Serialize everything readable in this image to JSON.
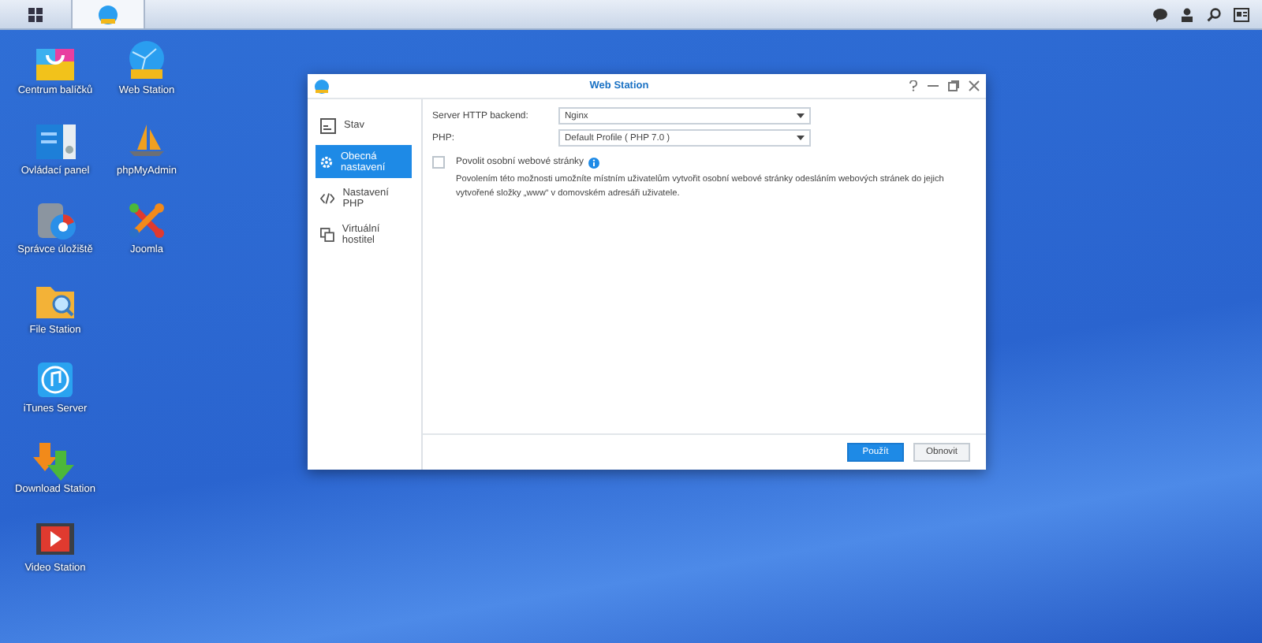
{
  "taskbar": {
    "buttons": [
      {
        "kind": "grid",
        "selected": false
      },
      {
        "kind": "globe",
        "selected": true
      }
    ]
  },
  "desktop_icons": [
    {
      "label": "Centrum balíčků",
      "kind": "bag"
    },
    {
      "label": "Ovládací panel",
      "kind": "panel"
    },
    {
      "label": "Správce úložiště",
      "kind": "storage"
    },
    {
      "label": "File Station",
      "kind": "folder"
    },
    {
      "label": "iTunes Server",
      "kind": "music"
    },
    {
      "label": "Download Station",
      "kind": "download"
    },
    {
      "label": "Video Station",
      "kind": "video"
    },
    {
      "label": "Web Station",
      "kind": "globe"
    },
    {
      "label": "phpMyAdmin",
      "kind": "sail"
    },
    {
      "label": "Joomla",
      "kind": "joomla"
    }
  ],
  "window": {
    "title": "Web Station",
    "sidebar": {
      "items": [
        {
          "label": "Stav",
          "kind": "status",
          "selected": false
        },
        {
          "label": "Obecná nastavení",
          "kind": "gear",
          "selected": true
        },
        {
          "label": "Nastavení PHP",
          "kind": "code",
          "selected": false
        },
        {
          "label": "Virtuální hostitel",
          "kind": "hosts",
          "selected": false
        }
      ]
    },
    "fields": [
      {
        "label": "Server HTTP backend:",
        "value": "Nginx"
      },
      {
        "label": "PHP:",
        "value": "Default Profile ( PHP 7.0 )"
      }
    ],
    "checkbox": {
      "label": "Povolit osobní webové stránky",
      "checked": false
    },
    "description": "Povolením této možnosti umožníte místním uživatelům vytvořit osobní webové stránky odesláním webových stránek do jejich vytvořené složky „www“ v domovském adresáři uživatele.",
    "buttons": [
      {
        "label": "Použít",
        "kind": "primary"
      },
      {
        "label": "Obnovit",
        "kind": "secondary"
      }
    ]
  }
}
